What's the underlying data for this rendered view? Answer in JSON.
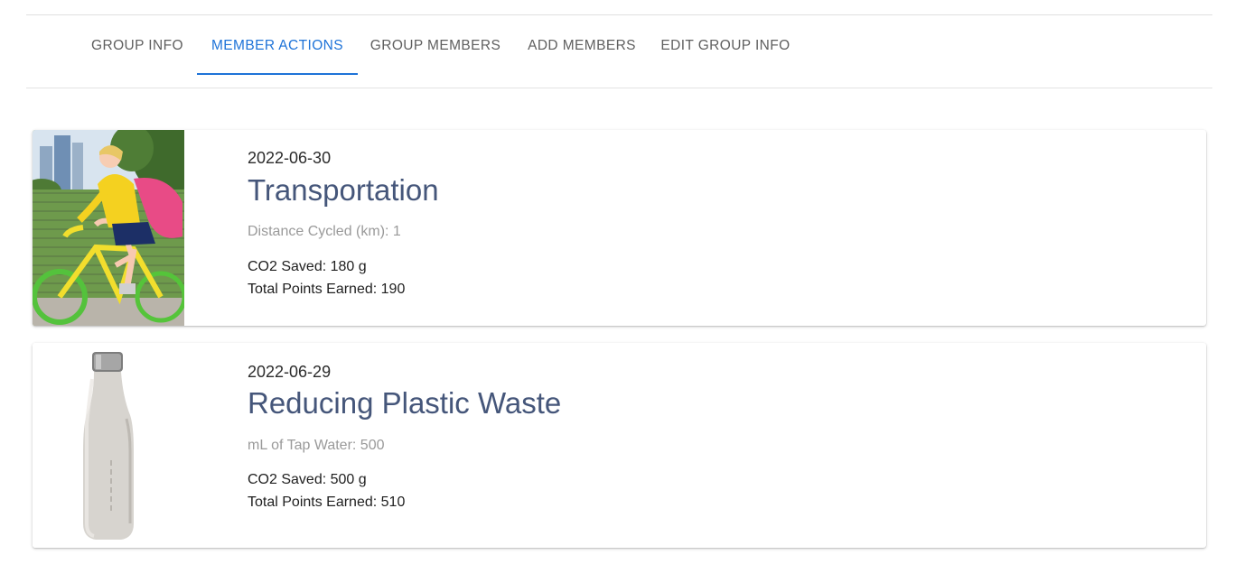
{
  "tabs": [
    {
      "label": "GROUP INFO",
      "active": false
    },
    {
      "label": "MEMBER ACTIONS",
      "active": true
    },
    {
      "label": "GROUP MEMBERS",
      "active": false
    },
    {
      "label": "ADD MEMBERS",
      "active": false
    },
    {
      "label": "EDIT GROUP INFO",
      "active": false
    }
  ],
  "colors": {
    "accent": "#1e73d8",
    "title": "#45567a",
    "muted": "#9a9a9a"
  },
  "actions": [
    {
      "image": "woman-cycling-photo",
      "date": "2022-06-30",
      "title": "Transportation",
      "detail": "Distance Cycled (km): 1",
      "co2": "CO2 Saved: 180 g",
      "points": "Total Points Earned: 190"
    },
    {
      "image": "reusable-water-bottle-photo",
      "date": "2022-06-29",
      "title": "Reducing Plastic Waste",
      "detail": "mL of Tap Water: 500",
      "co2": "CO2 Saved: 500 g",
      "points": "Total Points Earned: 510"
    }
  ]
}
